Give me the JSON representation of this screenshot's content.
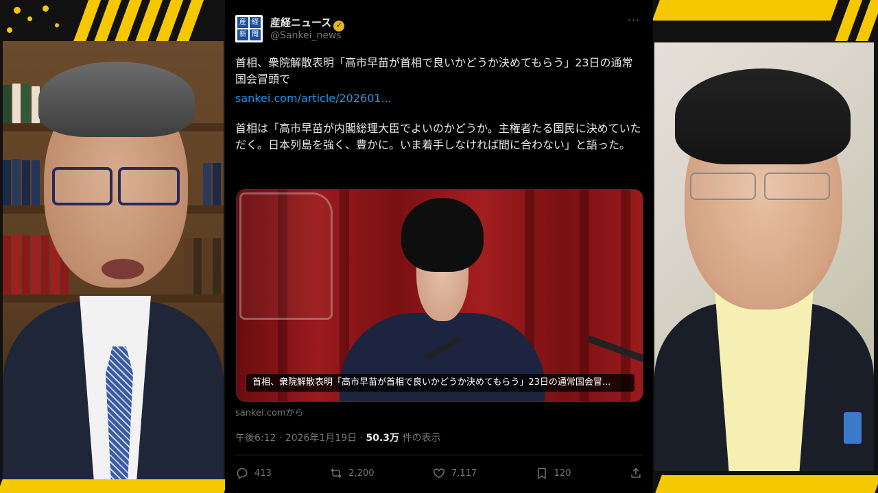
{
  "tweet": {
    "display_name": "産経ニュース",
    "handle": "@Sankei_news",
    "avatar_chars": [
      "産",
      "経",
      "新",
      "聞"
    ],
    "more_label": "···",
    "text_line1": "首相、衆院解散表明「高市早苗が首相で良いかどうか決めてもらう」23日の通常国会冒頭で",
    "link": "sankei.com/article/202601...",
    "text_line2": "首相は「高市早苗が内閣総理大臣でよいのかどうか。主権者たる国民に決めていただく。日本列島を強く、豊かに。いま着手しなければ間に合わない」と語った。",
    "card_caption": "首相、衆院解散表明「高市早苗が首相で良いかどうか決めてもらう」23日の通常国会冒...",
    "source": "sankei.comから",
    "timestamp": "午後6:12 · 2026年1月19日 · ",
    "views": "50.3万",
    "views_label": " 件の表示",
    "stats": {
      "replies": "413",
      "reposts": "2,200",
      "likes": "7,117",
      "bookmarks": "120"
    }
  },
  "colors": {
    "accent_yellow": "#f5c800",
    "link_blue": "#1d9bf0",
    "verified_gold": "#e2b719",
    "tweet_bg": "#000000"
  }
}
